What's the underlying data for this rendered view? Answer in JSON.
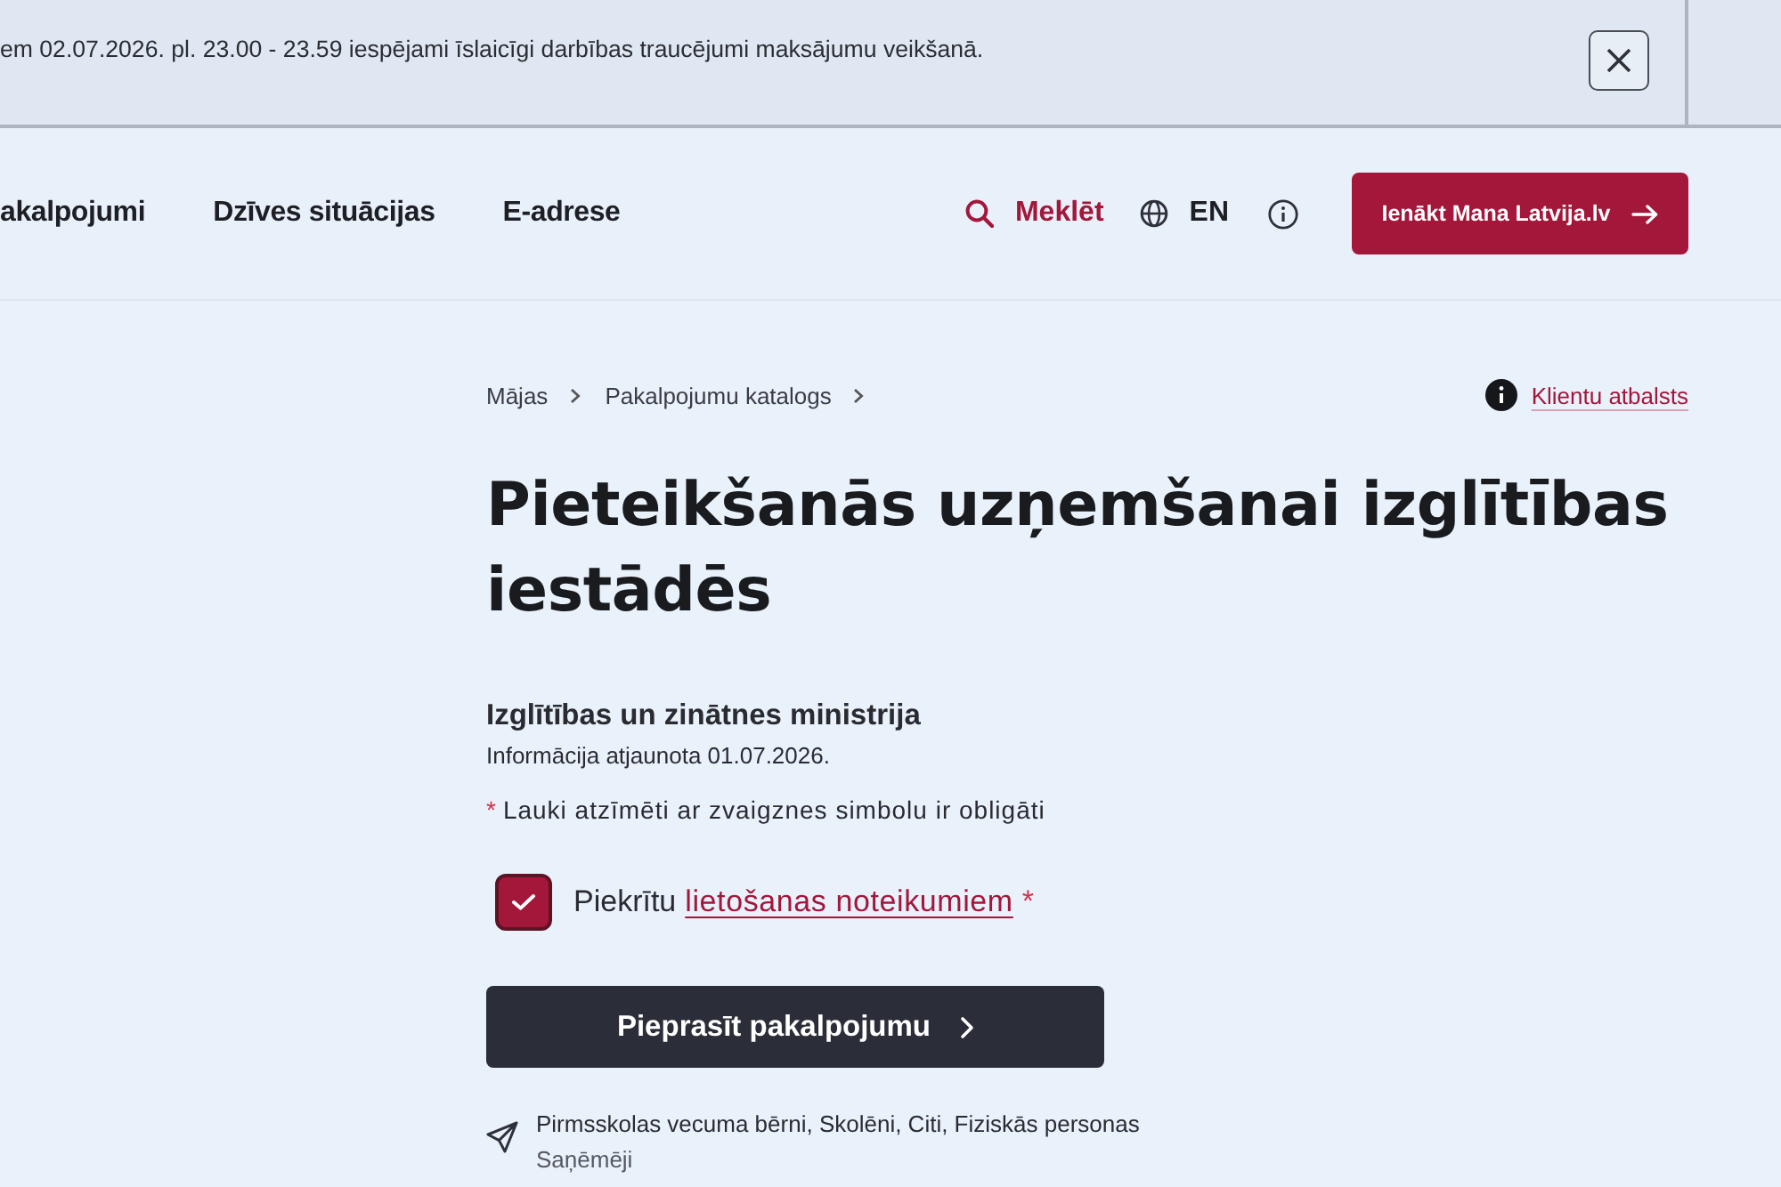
{
  "notice_banner": {
    "message": "em 02.07.2026. pl. 23.00 - 23.59 iespējami īslaicīgi darbības traucējumi maksājumu veikšanā."
  },
  "nav": {
    "items": [
      {
        "label": "akalpojumi"
      },
      {
        "label": "Dzīves situācijas"
      },
      {
        "label": "E-adrese"
      }
    ],
    "search": {
      "label": "Meklēt"
    },
    "language": {
      "label": "EN"
    },
    "login_button": {
      "label": "Ienākt Mana Latvija.lv"
    }
  },
  "breadcrumb": [
    {
      "label": "Mājas"
    },
    {
      "label": "Pakalpojumu katalogs"
    }
  ],
  "support_link": {
    "label": "Klientu atbalsts"
  },
  "page_title": "Pieteikšanās uzņemšanai izglītības iestādēs",
  "provider": {
    "name": "Izglītības un zinātnes ministrija",
    "updated": "Informācija atjaunota 01.07.2026."
  },
  "required_note": {
    "marker": "*",
    "text": "Lauki atzīmēti ar zvaigznes simbolu ir obligāti"
  },
  "consent": {
    "checked": true,
    "label": "Piekrītu",
    "link": "lietošanas noteikumiem",
    "marker": "*"
  },
  "submit_button": {
    "label": "Pieprasīt pakalpojumu"
  },
  "recipients": {
    "value": "Pirmsskolas vecuma bērni, Skolēni, Citi, Fiziskās personas",
    "label": "Saņēmēji"
  }
}
